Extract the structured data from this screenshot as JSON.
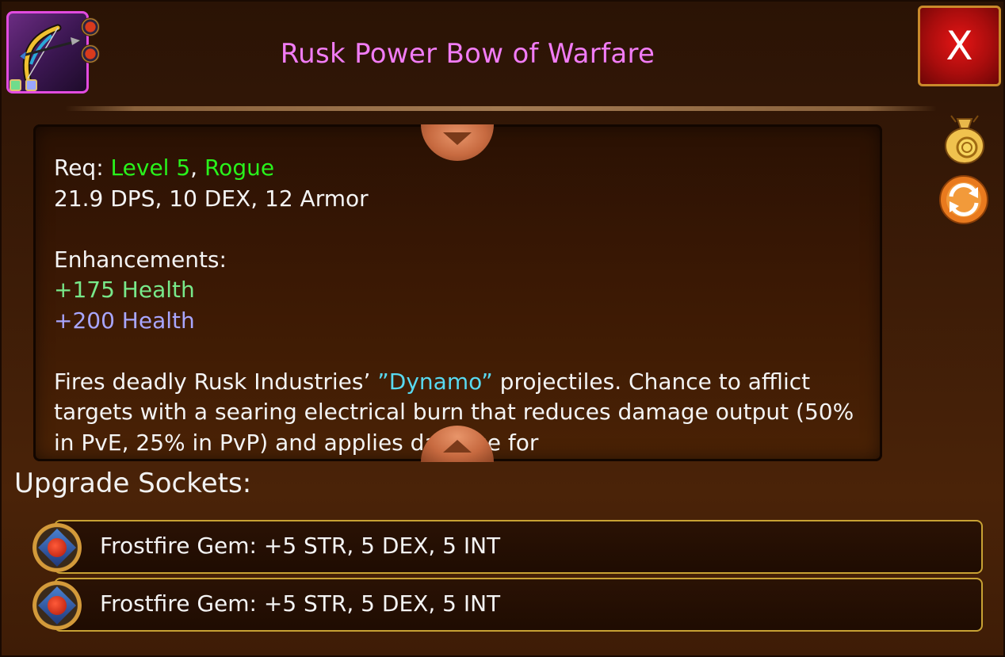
{
  "header": {
    "item_name": "Rusk Power Bow of Warfare",
    "item_name_color": "#f17cf5",
    "close_label": "X",
    "item_icon": "bow-icon",
    "item_rarity_color": "#e24be0"
  },
  "side_actions": {
    "sell_icon": "coin-bag-icon",
    "swap_icon": "swap-arrows-icon"
  },
  "description": {
    "req_label": "Req:",
    "req_level": "Level 5",
    "req_sep": ",",
    "req_class": "Rogue",
    "stats": "21.9 DPS, 10 DEX, 12 Armor",
    "enhancements_label": "Enhancements:",
    "enhancement_1": "+175 Health",
    "enhancement_2": "+200 Health",
    "flavor_pre": "Fires deadly Rusk Industries’",
    "flavor_highlight": "”Dynamo”",
    "flavor_post": "projectiles. Chance to afflict targets with a searing electrical burn that reduces damage output (50% in PvE, 25% in PvP) and applies damage for"
  },
  "sockets": {
    "heading": "Upgrade Sockets:",
    "items": [
      {
        "text": "Frostfire Gem: +5 STR, 5 DEX, 5 INT",
        "icon": "frostfire-gem-icon"
      },
      {
        "text": "Frostfire Gem: +5 STR, 5 DEX, 5 INT",
        "icon": "frostfire-gem-icon"
      }
    ]
  },
  "colors": {
    "requirement_met": "#29f21c",
    "enhancement_tier1": "#78e98a",
    "enhancement_tier2": "#a8a6ff",
    "highlight": "#58d9f0",
    "socket_border": "#c8a234"
  }
}
